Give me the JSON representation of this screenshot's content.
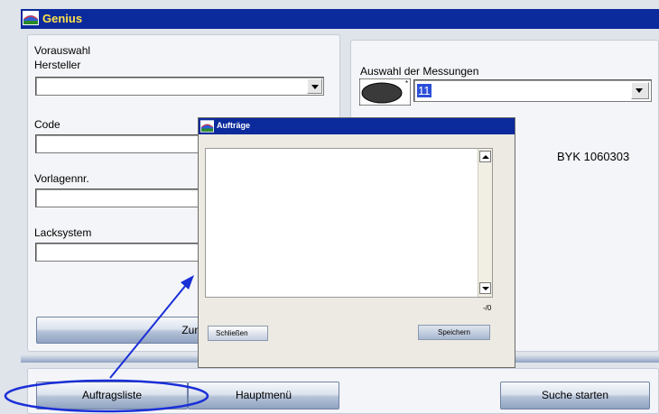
{
  "window": {
    "title": "Genius",
    "icon": "app-icon"
  },
  "preselection": {
    "heading": "Vorauswahl",
    "manufacturer_label": "Hersteller",
    "manufacturer_value": "",
    "code_label": "Code",
    "code_value": "",
    "template_label": "Vorlagennr.",
    "template_value": "",
    "paint_label": "Lacksystem",
    "paint_value": "",
    "reset_button": "Zurückset"
  },
  "measurements": {
    "label": "Auswahl der Messungen",
    "selected_value": "11",
    "device_text": "BYK 1060303"
  },
  "dialog": {
    "title": "Aufträge",
    "list_items": [],
    "counter": "-/0",
    "close_button": "Schließen",
    "save_button": "Speichern"
  },
  "footer": {
    "order_list_button": "Auftragsliste",
    "main_menu_button": "Hauptmenü",
    "start_search_button": "Suche starten"
  },
  "annotation": {
    "color": "#1a2fd6"
  }
}
